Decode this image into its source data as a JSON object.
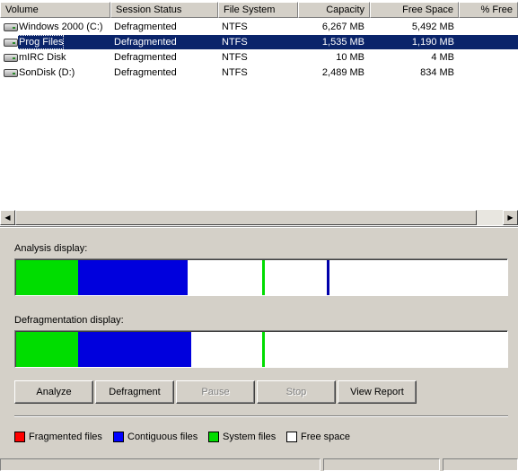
{
  "columns": [
    {
      "label": "Volume"
    },
    {
      "label": "Session Status"
    },
    {
      "label": "File System"
    },
    {
      "label": "Capacity"
    },
    {
      "label": "Free Space"
    },
    {
      "label": "% Free"
    }
  ],
  "volumes": [
    {
      "volume": "Windows 2000 (C:)",
      "status": "Defragmented",
      "fs": "NTFS",
      "capacity": "6,267 MB",
      "free": "5,492 MB",
      "selected": false
    },
    {
      "volume": "Prog Files",
      "status": "Defragmented",
      "fs": "NTFS",
      "capacity": "1,535 MB",
      "free": "1,190 MB",
      "selected": true
    },
    {
      "volume": "mIRC Disk",
      "status": "Defragmented",
      "fs": "NTFS",
      "capacity": "10 MB",
      "free": "4 MB",
      "selected": false
    },
    {
      "volume": "SonDisk (D:)",
      "status": "Defragmented",
      "fs": "NTFS",
      "capacity": "2,489 MB",
      "free": "834 MB",
      "selected": false
    }
  ],
  "analysis_label": "Analysis display:",
  "defrag_label": "Defragmentation display:",
  "buttons": {
    "analyze": "Analyze",
    "defragment": "Defragment",
    "pause": "Pause",
    "stop": "Stop",
    "view_report": "View Report"
  },
  "legend": {
    "fragmented": "Fragmented files",
    "contiguous": "Contiguous files",
    "system": "System files",
    "free": "Free space"
  },
  "colors": {
    "fragmented": "#ff0000",
    "contiguous": "#0000ff",
    "system": "#00dd00",
    "free": "#ffffff",
    "selection": "#0a246a"
  }
}
